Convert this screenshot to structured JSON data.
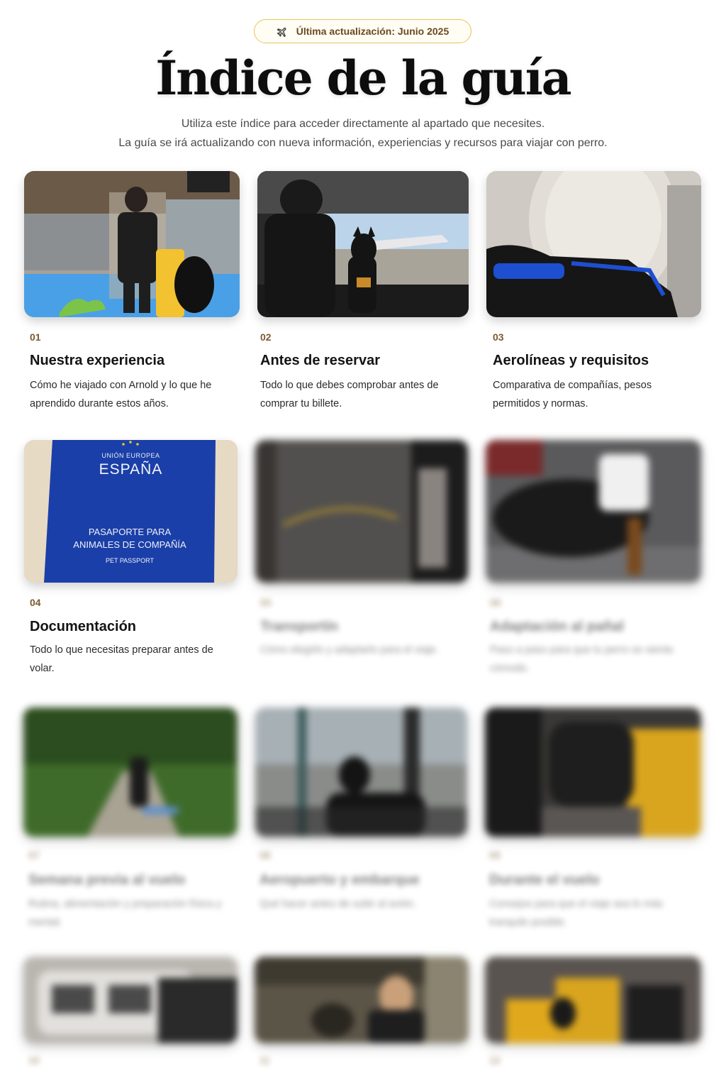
{
  "badge": {
    "icon": "plane-icon",
    "text": "Última actualización: Junio 2025"
  },
  "page": {
    "title": "Índice de la guía",
    "subtitle_line1": "Utiliza este índice para acceder directamente al apartado que necesites.",
    "subtitle_line2": "La guía se irá actualizando con nueva información, experiencias y recursos para viajar con perro."
  },
  "cards": [
    {
      "number": "01",
      "title": "Nuestra experiencia",
      "description": "Cómo he viajado con Arnold y lo que he aprendido durante estos años.",
      "image": "airport-woman-dog-photo"
    },
    {
      "number": "02",
      "title": "Antes de reservar",
      "description": "Todo lo que debes comprobar antes de comprar tu billete.",
      "image": "terminal-window-dog-photo"
    },
    {
      "number": "03",
      "title": "Aerolíneas y requisitos",
      "description": "Comparativa de compañías, pesos permitidos y normas.",
      "image": "cabin-carrier-bag-photo"
    },
    {
      "number": "04",
      "title": "Documentación",
      "description": "Todo lo que necesitas preparar antes de volar.",
      "image": "pet-passport-photo",
      "passport": {
        "top": "UNIÓN EUROPEA",
        "country": "ESPAÑA",
        "line1": "PASAPORTE PARA",
        "line2": "ANIMALES DE COMPAÑÍA",
        "line3": "PET PASSPORT"
      }
    },
    {
      "number": "05",
      "title": "Transportín",
      "description": "Cómo elegirlo y adaptarlo para el viaje.",
      "image": "carrier-photo"
    },
    {
      "number": "06",
      "title": "Adaptación al pañal",
      "description": "Paso a paso para que tu perro se sienta cómodo.",
      "image": "dog-diaper-photo"
    },
    {
      "number": "07",
      "title": "Semana previa al vuelo",
      "description": "Rutina, alimentación y preparación física y mental.",
      "image": "forest-walk-photo"
    },
    {
      "number": "08",
      "title": "Aeropuerto y embarque",
      "description": "Qué hacer antes de subir al avión.",
      "image": "airport-window-dog-photo"
    },
    {
      "number": "09",
      "title": "Durante el vuelo",
      "description": "Consejos para que el viaje sea lo más tranquilo posible.",
      "image": "in-flight-photo"
    },
    {
      "number": "10",
      "title": "",
      "description": "",
      "image": "crate-photo"
    },
    {
      "number": "11",
      "title": "",
      "description": "",
      "image": "woman-dog-photo"
    },
    {
      "number": "12",
      "title": "",
      "description": "",
      "image": "luggage-dog-photo"
    }
  ],
  "colors": {
    "accent": "#7a5a2f",
    "badge_border": "#e6c45c",
    "passport_blue": "#1b3fa8"
  }
}
